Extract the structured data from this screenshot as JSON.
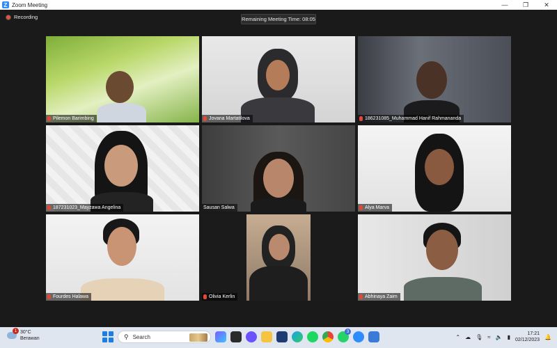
{
  "window": {
    "title": "Zoom Meeting",
    "app_icon": "Z"
  },
  "meeting": {
    "recording_label": "Recording",
    "remaining_time": "Remaining Meeting Time: 08:05",
    "participants": [
      {
        "name": "Pilemon Barimbing",
        "muted": true
      },
      {
        "name": "Jovana Martatilova",
        "muted": true
      },
      {
        "name": "186231085_Muhammad Hanif Rahmananda",
        "muted": true
      },
      {
        "name": "187231023_Mayzawa Angelina",
        "muted": true
      },
      {
        "name": "Sausan Salwa",
        "muted": false,
        "active_speaker": true
      },
      {
        "name": "Alya Marva",
        "muted": true
      },
      {
        "name": "Fourdes Halawa",
        "muted": true
      },
      {
        "name": "Olivia Kerlin",
        "muted": true
      },
      {
        "name": "Abhinaya Zaim",
        "muted": true
      }
    ]
  },
  "taskbar": {
    "weather": {
      "temp": "30°C",
      "condition": "Berawan",
      "badge": "1"
    },
    "search_label": "Search",
    "whatsapp_badge": "3",
    "time": "17:21",
    "date": "02/12/2023"
  }
}
